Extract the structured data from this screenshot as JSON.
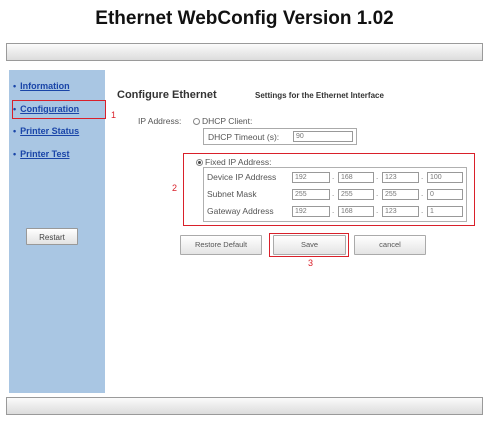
{
  "page_title": "Ethernet WebConfig Version 1.02",
  "sidebar": {
    "items": [
      {
        "label": "Information"
      },
      {
        "label": "Configuration"
      },
      {
        "label": "Printer Status"
      },
      {
        "label": "Printer Test"
      }
    ],
    "restart_label": "Restart"
  },
  "main": {
    "title": "Configure Ethernet",
    "subtitle": "Settings for the Ethernet Interface",
    "ip_address_label": "IP Address:",
    "dhcp_client_label": "DHCP Client:",
    "dhcp_timeout_label": "DHCP Timeout (s):",
    "dhcp_timeout_value": "90",
    "fixed_ip_label": "Fixed IP Address:",
    "fixed_ip_selected": true,
    "rows": [
      {
        "label": "Device IP Address",
        "octets": [
          "192",
          "168",
          "123",
          "100"
        ]
      },
      {
        "label": "Subnet Mask",
        "octets": [
          "255",
          "255",
          "255",
          "0"
        ]
      },
      {
        "label": "Gateway Address",
        "octets": [
          "192",
          "168",
          "123",
          "1"
        ]
      }
    ],
    "buttons": {
      "restore": "Restore Default",
      "save": "Save",
      "cancel": "cancel"
    }
  },
  "annotations": {
    "marker_1": "1",
    "marker_2": "2",
    "marker_3": "3"
  },
  "colors": {
    "sidebar_bg": "#a9c6e3",
    "link": "#1a45a8",
    "annotation_red": "#d9202a"
  }
}
